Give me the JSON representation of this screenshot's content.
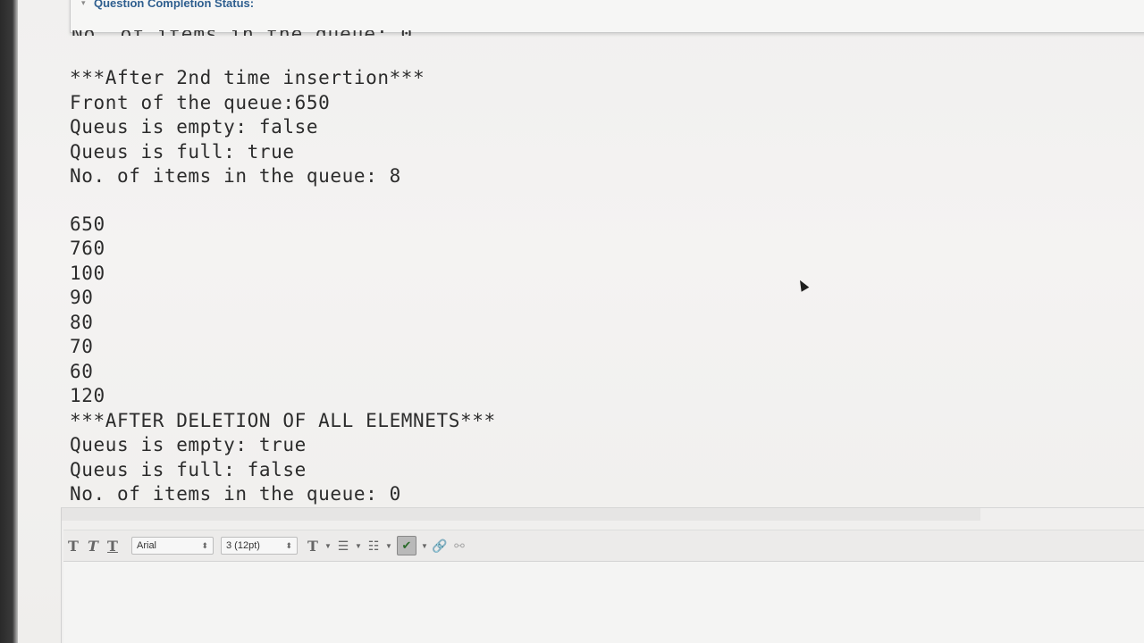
{
  "status_bar": {
    "label": "Question Completion Status:"
  },
  "console": {
    "lines": [
      "***After 2nd time insertion***",
      "Front of the queue:650",
      "Queus is empty: false",
      "Queus is full: true",
      "No. of items in the queue: 8",
      "650",
      "760",
      "100",
      "90",
      "80",
      "70",
      "60",
      "120",
      "***AFTER DELETION OF ALL ELEMNETS***",
      "Queus is empty: true",
      "Queus is full: false",
      "No. of items in the queue: 0"
    ]
  },
  "toolbar": {
    "font_family": "Arial",
    "font_size": "3 (12pt)",
    "buttons": [
      "T",
      "T",
      "T"
    ],
    "text_color_button": "T"
  }
}
